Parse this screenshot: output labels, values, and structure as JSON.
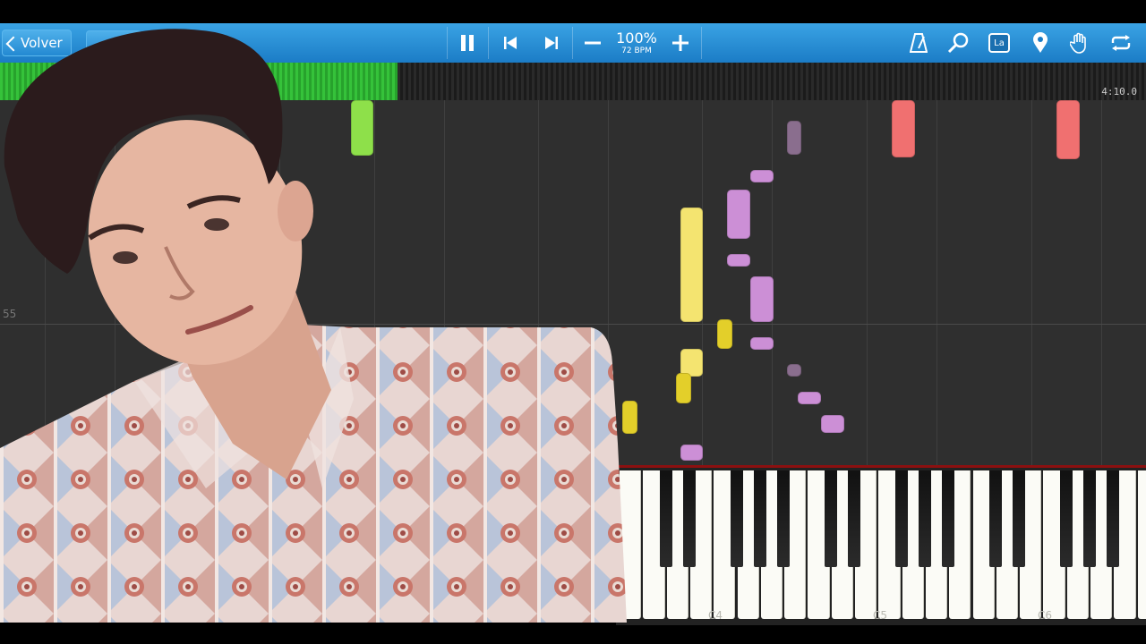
{
  "toolbar": {
    "back_label": "Volver",
    "pause_icon": "pause-icon",
    "prev_icon": "skip-back-icon",
    "next_icon": "skip-forward-icon",
    "zoom_out_icon": "minus-icon",
    "zoom_in_icon": "plus-icon",
    "speed_percent": "100%",
    "tempo": "72 BPM",
    "right_icons": [
      "metronome-icon",
      "search-icon",
      "key-label-icon",
      "marker-icon",
      "hand-icon",
      "loop-icon"
    ],
    "key_label_text": "La"
  },
  "progress": {
    "fraction": 0.347,
    "time": "4:10.0"
  },
  "field": {
    "measure_number": "55"
  },
  "keyboard": {
    "labels": [
      "C4",
      "C5",
      "C6"
    ]
  },
  "colors": {
    "toolbar": "#1b7cc6",
    "progress_green": "#35c23a",
    "field_bg": "#2f2f2f",
    "note_green": "#8ee04a",
    "note_red": "#f07070",
    "note_yellow": "#f4e470",
    "note_gold": "#e3cf2a",
    "note_purple": "#cc8fd6",
    "note_darkpurple": "#8a6e8e"
  }
}
